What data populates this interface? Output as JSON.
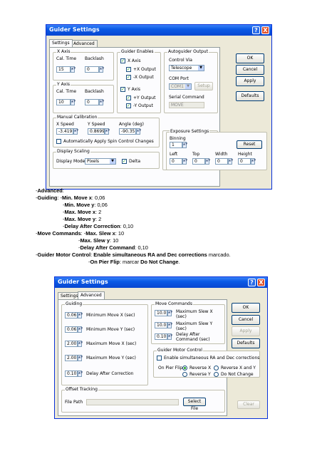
{
  "win1": {
    "title": "Guider Settings",
    "help_btn": "?",
    "close_btn": "X",
    "tabs": [
      "Settings",
      "Advanced"
    ],
    "x_axis": {
      "title": "X Axis",
      "cal_time_label": "Cal. Time",
      "backlash_label": "Backlash",
      "cal_time": "15",
      "backlash": "0"
    },
    "y_axis": {
      "title": "Y Axis",
      "cal_time_label": "Cal. Time",
      "backlash_label": "Backlash",
      "cal_time": "10",
      "backlash": "0"
    },
    "enables": {
      "title": "Guider Enables",
      "x_axis": "X Axis",
      "x_plus": "+X Output",
      "x_minus": "-X Output",
      "y_axis": "Y Axis",
      "y_plus": "+Y Output",
      "y_minus": "-Y Output"
    },
    "autoguider": {
      "title": "Autoguider Output",
      "control_via_label": "Control Via",
      "control_via": "Telescope",
      "com_port_label": "COM Port",
      "com_port": "COM1",
      "setup": "Setup",
      "serial_cmd_label": "Serial Command",
      "serial_cmd": "MOVE"
    },
    "manual_cal": {
      "title": "Manual Calibration",
      "x_speed_label": "X Speed",
      "y_speed_label": "Y Speed",
      "angle_label": "Angle (deg)",
      "x_speed": "-3.419",
      "y_speed": "0.8699",
      "angle": "-90.35",
      "auto_apply": "Automatically Apply Spin Control Changes"
    },
    "display_scaling": {
      "title": "Display Scaling",
      "mode_label": "Display Mode",
      "mode": "Pixels",
      "delta": "Delta"
    },
    "exposure": {
      "title": "Exposure Settings",
      "binning_label": "Binning",
      "binning": "1",
      "reset": "Reset",
      "left_label": "Left",
      "top_label": "Top",
      "width_label": "Width",
      "height_label": "Height",
      "left": "0",
      "top": "0",
      "width": "0",
      "height": "0"
    },
    "buttons": {
      "ok": "OK",
      "cancel": "Cancel",
      "apply": "Apply",
      "defaults": "Defaults"
    }
  },
  "captions": [
    {
      "prefix": "-",
      "bold": "Advanced",
      "rest": ":"
    },
    {
      "prefix": "-",
      "bold": "Guiding",
      "rest": ":  -",
      "bold2": "Min. Move x",
      "rest2": ": 0,06"
    },
    {
      "prefix": "-",
      "bold": "Min. Move y",
      "rest": ": 0,06"
    },
    {
      "prefix": "-",
      "bold": "Max. Move x",
      "rest": ": 2"
    },
    {
      "prefix": "-",
      "bold": "Max. Move y",
      "rest": ": 2"
    },
    {
      "prefix": "-",
      "bold": "Delay After Correction",
      "rest": ": 0,10"
    },
    {
      "prefix": "-",
      "bold": "Move Commands",
      "rest": ": -",
      "bold2": "Max. Slew x",
      "rest2": ": 10"
    },
    {
      "prefix": "-",
      "bold": "Max. Slew y",
      "rest": ": 10"
    },
    {
      "prefix": "-",
      "bold": "Delay After Command",
      "rest": ": 0,10"
    },
    {
      "prefix": "-",
      "bold": "Guider Motor Control",
      "rest": ":  ",
      "bold2": "Enable simultaneous RA and Dec corrections",
      "rest2": " marcado."
    },
    {
      "prefix": "-",
      "bold": "On Pier Flip",
      "rest": ": marcar ",
      "bold2": "Do Not Change",
      "rest2": "."
    }
  ],
  "win2": {
    "title": "Guider Settings",
    "help_btn": "?",
    "close_btn": "X",
    "tabs": [
      "Settings",
      "Advanced"
    ],
    "guiding": {
      "title": "Guiding",
      "min_x": "0.06",
      "min_x_label": "Minimum Move X (sec)",
      "min_y": "0.06",
      "min_y_label": "Minimum Move Y (sec)",
      "max_x": "2.00",
      "max_x_label": "Maximum Move X (sec)",
      "max_y": "2.00",
      "max_y_label": "Maximum Move Y (sec)",
      "delay": "0.10",
      "delay_label": "Delay After Correction"
    },
    "move_commands": {
      "title": "Move Commands",
      "slew_x": "10.0",
      "slew_x_label": "Maximum Slew X (sec)",
      "slew_y": "10.0",
      "slew_y_label": "Maximum Slew Y (sec)",
      "delay": "0.10",
      "delay_label": "Delay After Command (sec)"
    },
    "motor": {
      "title": "Guider Motor Control",
      "enable": "Enable simultaneous RA and Dec corrections",
      "pier_flip_label": "On Pier Flip:",
      "reverse_x": "Reverse X",
      "reverse_xy": "Reverse X and Y",
      "reverse_y": "Reverse Y",
      "do_not_change": "Do Not Change"
    },
    "offset": {
      "title": "Offset Tracking",
      "file_path_label": "File Path",
      "file_path": "",
      "select_file": "Select File",
      "clear": "Clear"
    },
    "buttons": {
      "ok": "OK",
      "cancel": "Cancel",
      "apply": "Apply",
      "defaults": "Defaults"
    }
  }
}
